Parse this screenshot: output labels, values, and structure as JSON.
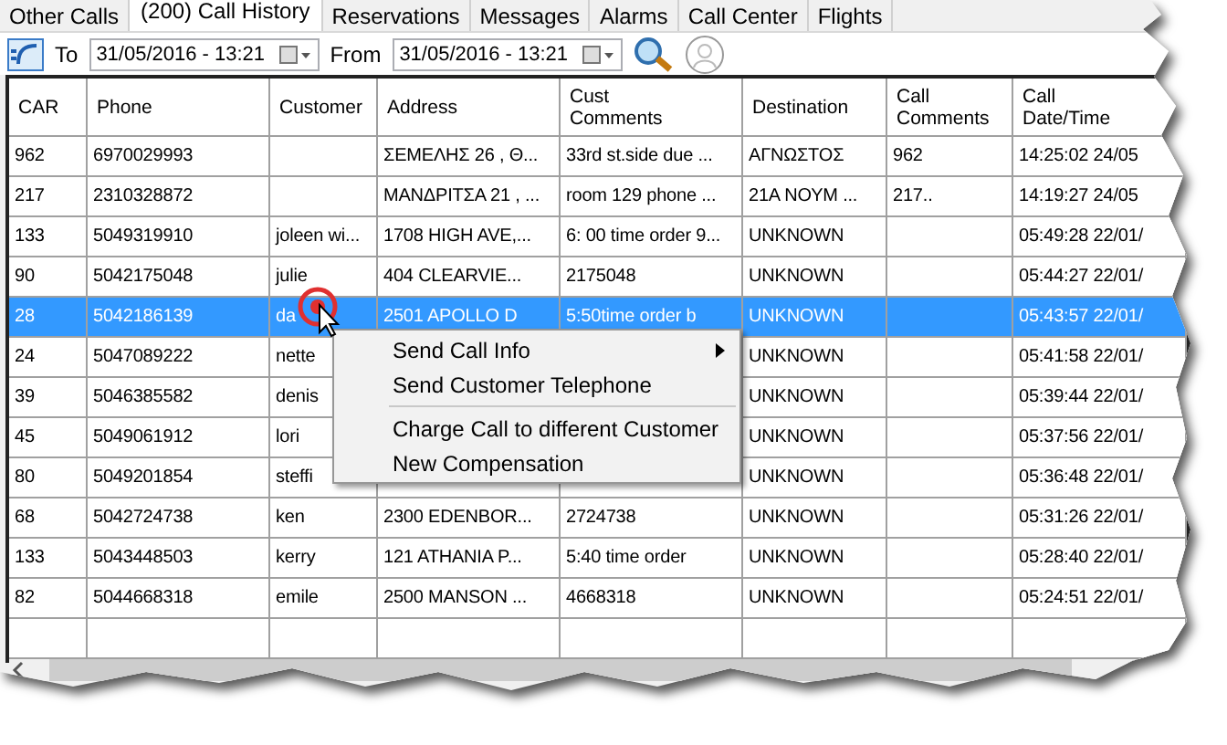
{
  "tabs": [
    {
      "label": "Other Calls",
      "selected": false
    },
    {
      "label": "(200) Call History",
      "selected": true
    },
    {
      "label": "Reservations",
      "selected": false
    },
    {
      "label": "Messages",
      "selected": false
    },
    {
      "label": "Alarms",
      "selected": false
    },
    {
      "label": "Call Center",
      "selected": false
    },
    {
      "label": "Flights",
      "selected": false
    }
  ],
  "toolbar": {
    "to_label": "To",
    "to_value": "31/05/2016 - 13:21",
    "from_label": "From",
    "from_value": "31/05/2016 - 13:21"
  },
  "table": {
    "columns": [
      "CAR",
      "Phone",
      "Customer",
      "Address",
      "Cust\nComments",
      "Destination",
      "Call\nComments",
      "Call\nDate/Time"
    ],
    "rows": [
      {
        "selected": false,
        "cells": [
          "962",
          "6970029993",
          null,
          "ΣΕΜΕΛΗΣ 26 , Θ...",
          "33rd st.side due ...",
          "ΑΓΝΩΣΤΟΣ",
          "962",
          "14:25:02 24/05"
        ]
      },
      {
        "selected": false,
        "cells": [
          "217",
          "2310328872",
          null,
          "ΜΑΝΔΡΙΤΣΑ 21 , ...",
          "room 129 phone ...",
          "21Α  ΝΟΥΜ ...",
          "217..",
          "14:19:27 24/05"
        ]
      },
      {
        "selected": false,
        "cells": [
          "133",
          "5049319910",
          "joleen wi...",
          "1708 HIGH AVE,...",
          "6: 00 time order 9...",
          "UNKNOWN",
          null,
          "05:49:28 22/01/"
        ]
      },
      {
        "selected": false,
        "cells": [
          "90",
          "5042175048",
          "julie",
          "404 CLEARVIE...",
          "2175048",
          "UNKNOWN",
          null,
          "05:44:27 22/01/"
        ]
      },
      {
        "selected": true,
        "cells": [
          "28",
          "5042186139",
          "da",
          "2501 APOLLO D",
          "5:50time order b",
          "UNKNOWN",
          null,
          "05:43:57 22/01/"
        ]
      },
      {
        "selected": false,
        "cells": [
          "24",
          "5047089222",
          "nette",
          null,
          null,
          "UNKNOWN",
          null,
          "05:41:58 22/01/"
        ]
      },
      {
        "selected": false,
        "cells": [
          "39",
          "5046385582",
          "denis",
          null,
          null,
          "UNKNOWN",
          null,
          "05:39:44 22/01/"
        ]
      },
      {
        "selected": false,
        "cells": [
          "45",
          "5049061912",
          "lori",
          null,
          null,
          "UNKNOWN",
          null,
          "05:37:56 22/01/"
        ]
      },
      {
        "selected": false,
        "cells": [
          "80",
          "5049201854",
          "steffi",
          null,
          null,
          "UNKNOWN",
          null,
          "05:36:48 22/01/"
        ]
      },
      {
        "selected": false,
        "cells": [
          "68",
          "5042724738",
          "ken",
          "2300 EDENBOR...",
          "2724738",
          "UNKNOWN",
          null,
          "05:31:26 22/01/"
        ]
      },
      {
        "selected": false,
        "cells": [
          "133",
          "5043448503",
          "kerry",
          "121 ATHANIA P...",
          "5:40 time order",
          "UNKNOWN",
          null,
          "05:28:40 22/01/"
        ]
      },
      {
        "selected": false,
        "cells": [
          "82",
          "5044668318",
          "emile",
          "2500 MANSON ...",
          "4668318",
          "UNKNOWN",
          null,
          "05:24:51 22/01/"
        ]
      }
    ]
  },
  "context_menu": {
    "items": [
      {
        "kind": "submenu",
        "label": "Send Call Info"
      },
      {
        "kind": "item",
        "label": "Send Customer Telephone"
      },
      {
        "kind": "separator"
      },
      {
        "kind": "item",
        "label": "Charge Call to different Customer"
      },
      {
        "kind": "item",
        "label": "New Compensation"
      }
    ]
  }
}
